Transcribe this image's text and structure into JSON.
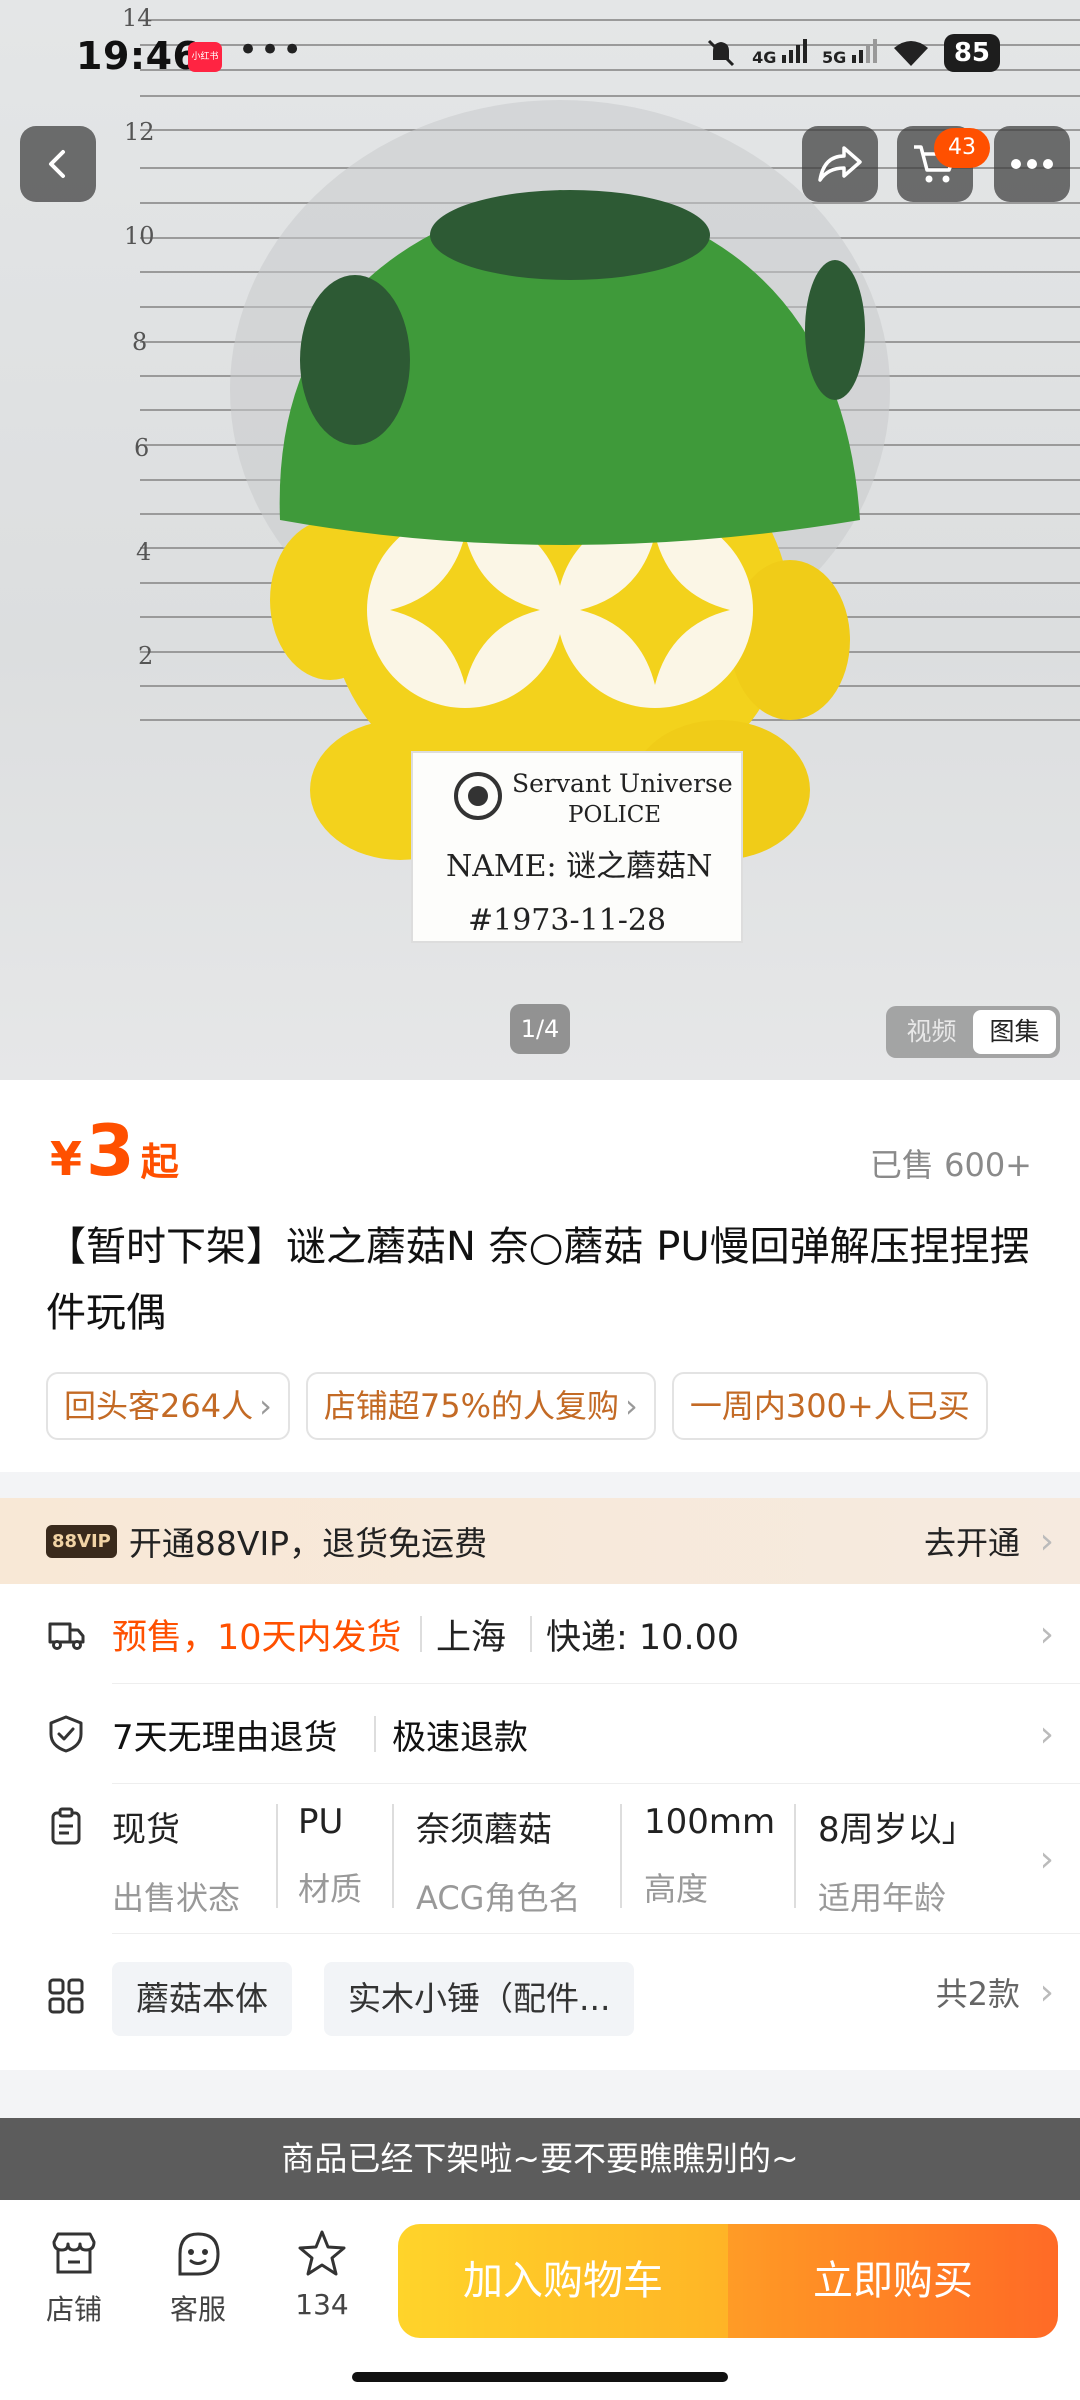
{
  "status_bar": {
    "time": "19:46",
    "app_badge": "小红书",
    "overflow_dots": "•••",
    "net_4g": "4G",
    "net_5g": "5G",
    "battery": "85"
  },
  "gallery": {
    "page_indicator": "1/4",
    "tab_video": "视频",
    "tab_album": "图集",
    "cart_count": "43",
    "photo_card": {
      "line1": "Servant Universe",
      "line2": "POLICE",
      "line3": "NAME: 谜之蘑菇N",
      "line4": "#1973-11-28"
    },
    "ruler_marks": [
      "14",
      "12",
      "10",
      "8",
      "6",
      "4",
      "2"
    ]
  },
  "product": {
    "price_symbol": "¥",
    "price": "3",
    "price_suffix": "起",
    "sold": "已售 600+",
    "title": "【暂时下架】谜之蘑菇N 奈○蘑菇 PU慢回弹解压捏捏摆件玩偶",
    "chips": [
      "回头客264人",
      "店铺超75%的人复购",
      "一周内300+人已买"
    ]
  },
  "vip": {
    "badge": "88VIP",
    "text": "开通88VIP，退货免运费",
    "action": "去开通"
  },
  "shipping": {
    "presale": "预售，10天内发货",
    "origin": "上海",
    "fee": "快递: 10.00"
  },
  "returns": {
    "policy": "7天无理由退货",
    "refund": "极速退款"
  },
  "attributes": [
    {
      "value": "现货",
      "label": "出售状态"
    },
    {
      "value": "PU",
      "label": "材质"
    },
    {
      "value": "奈须蘑菇",
      "label": "ACG角色名"
    },
    {
      "value": "100mm",
      "label": "高度"
    },
    {
      "value": "8周岁以」",
      "label": "适用年龄"
    }
  ],
  "sku": {
    "options": [
      "蘑菇本体",
      "实木小锤（配件..."
    ],
    "total": "共2款"
  },
  "notice": "商品已经下架啦~要不要瞧瞧别的~",
  "bottom_bar": {
    "store": "店铺",
    "service": "客服",
    "favorites": "134",
    "add_to_cart": "加入购物车",
    "buy_now": "立即购买"
  },
  "colors": {
    "accent": "#ff5000",
    "mushroom_cap": "#3f9a3a",
    "mushroom_body": "#f3d21c"
  }
}
